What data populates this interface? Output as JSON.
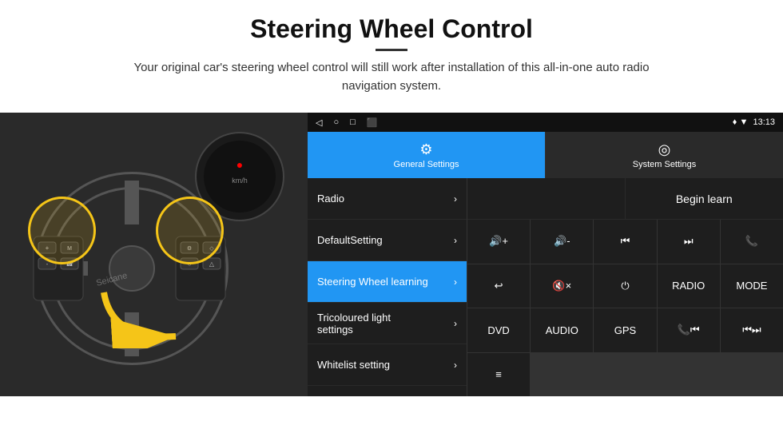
{
  "header": {
    "title": "Steering Wheel Control",
    "subtitle": "Your original car's steering wheel control will still work after installation of this all-in-one auto radio navigation system."
  },
  "status_bar": {
    "icons": [
      "◁",
      "○",
      "□",
      "⬛"
    ],
    "right": "♦ ▼  13:13"
  },
  "tabs": [
    {
      "id": "general",
      "label": "General Settings",
      "icon": "⚙",
      "active": true
    },
    {
      "id": "system",
      "label": "System Settings",
      "icon": "◎",
      "active": false
    }
  ],
  "menu": [
    {
      "id": "radio",
      "label": "Radio",
      "active": false
    },
    {
      "id": "default",
      "label": "DefaultSetting",
      "active": false
    },
    {
      "id": "steering",
      "label": "Steering Wheel learning",
      "active": true
    },
    {
      "id": "tricoloured",
      "label": "Tricoloured light settings",
      "active": false
    },
    {
      "id": "whitelist",
      "label": "Whitelist setting",
      "active": false
    }
  ],
  "begin_learn_label": "Begin learn",
  "controls": [
    {
      "label": "🔇+",
      "id": "vol-up"
    },
    {
      "label": "🔇-",
      "id": "vol-down"
    },
    {
      "label": "⏮",
      "id": "prev"
    },
    {
      "label": "⏭",
      "id": "next"
    },
    {
      "label": "📞",
      "id": "call"
    },
    {
      "label": "↩",
      "id": "back"
    },
    {
      "label": "🔇×",
      "id": "mute"
    },
    {
      "label": "⏻",
      "id": "power"
    },
    {
      "label": "RADIO",
      "id": "radio-btn"
    },
    {
      "label": "MODE",
      "id": "mode"
    },
    {
      "label": "DVD",
      "id": "dvd"
    },
    {
      "label": "AUDIO",
      "id": "audio"
    },
    {
      "label": "GPS",
      "id": "gps"
    },
    {
      "label": "📞⏮",
      "id": "call-prev"
    },
    {
      "label": "⏮⏭",
      "id": "skip"
    },
    {
      "label": "☰",
      "id": "menu-icon"
    }
  ]
}
